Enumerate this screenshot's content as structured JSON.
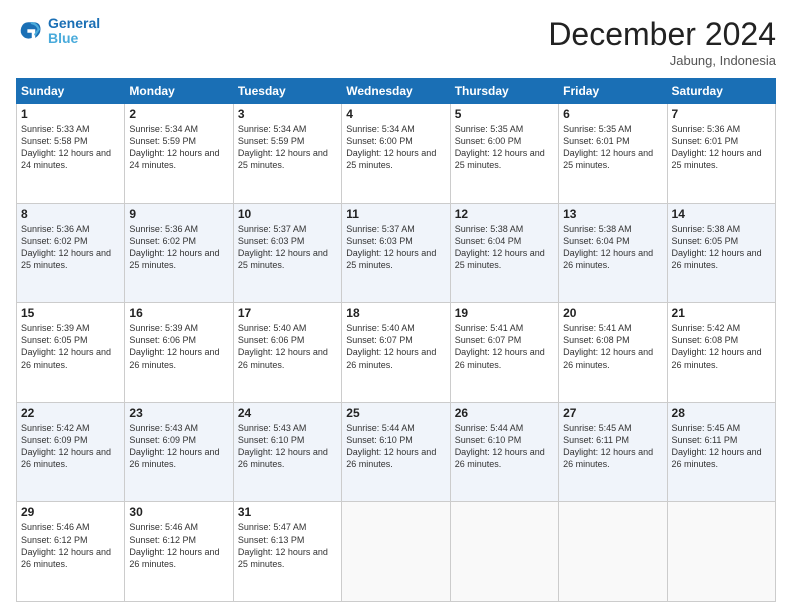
{
  "header": {
    "logo_line1": "General",
    "logo_line2": "Blue",
    "month_title": "December 2024",
    "location": "Jabung, Indonesia"
  },
  "days_of_week": [
    "Sunday",
    "Monday",
    "Tuesday",
    "Wednesday",
    "Thursday",
    "Friday",
    "Saturday"
  ],
  "weeks": [
    [
      {
        "day": "1",
        "sunrise": "5:33 AM",
        "sunset": "5:58 PM",
        "daylight": "12 hours and 24 minutes."
      },
      {
        "day": "2",
        "sunrise": "5:34 AM",
        "sunset": "5:59 PM",
        "daylight": "12 hours and 24 minutes."
      },
      {
        "day": "3",
        "sunrise": "5:34 AM",
        "sunset": "5:59 PM",
        "daylight": "12 hours and 25 minutes."
      },
      {
        "day": "4",
        "sunrise": "5:34 AM",
        "sunset": "6:00 PM",
        "daylight": "12 hours and 25 minutes."
      },
      {
        "day": "5",
        "sunrise": "5:35 AM",
        "sunset": "6:00 PM",
        "daylight": "12 hours and 25 minutes."
      },
      {
        "day": "6",
        "sunrise": "5:35 AM",
        "sunset": "6:01 PM",
        "daylight": "12 hours and 25 minutes."
      },
      {
        "day": "7",
        "sunrise": "5:36 AM",
        "sunset": "6:01 PM",
        "daylight": "12 hours and 25 minutes."
      }
    ],
    [
      {
        "day": "8",
        "sunrise": "5:36 AM",
        "sunset": "6:02 PM",
        "daylight": "12 hours and 25 minutes."
      },
      {
        "day": "9",
        "sunrise": "5:36 AM",
        "sunset": "6:02 PM",
        "daylight": "12 hours and 25 minutes."
      },
      {
        "day": "10",
        "sunrise": "5:37 AM",
        "sunset": "6:03 PM",
        "daylight": "12 hours and 25 minutes."
      },
      {
        "day": "11",
        "sunrise": "5:37 AM",
        "sunset": "6:03 PM",
        "daylight": "12 hours and 25 minutes."
      },
      {
        "day": "12",
        "sunrise": "5:38 AM",
        "sunset": "6:04 PM",
        "daylight": "12 hours and 25 minutes."
      },
      {
        "day": "13",
        "sunrise": "5:38 AM",
        "sunset": "6:04 PM",
        "daylight": "12 hours and 26 minutes."
      },
      {
        "day": "14",
        "sunrise": "5:38 AM",
        "sunset": "6:05 PM",
        "daylight": "12 hours and 26 minutes."
      }
    ],
    [
      {
        "day": "15",
        "sunrise": "5:39 AM",
        "sunset": "6:05 PM",
        "daylight": "12 hours and 26 minutes."
      },
      {
        "day": "16",
        "sunrise": "5:39 AM",
        "sunset": "6:06 PM",
        "daylight": "12 hours and 26 minutes."
      },
      {
        "day": "17",
        "sunrise": "5:40 AM",
        "sunset": "6:06 PM",
        "daylight": "12 hours and 26 minutes."
      },
      {
        "day": "18",
        "sunrise": "5:40 AM",
        "sunset": "6:07 PM",
        "daylight": "12 hours and 26 minutes."
      },
      {
        "day": "19",
        "sunrise": "5:41 AM",
        "sunset": "6:07 PM",
        "daylight": "12 hours and 26 minutes."
      },
      {
        "day": "20",
        "sunrise": "5:41 AM",
        "sunset": "6:08 PM",
        "daylight": "12 hours and 26 minutes."
      },
      {
        "day": "21",
        "sunrise": "5:42 AM",
        "sunset": "6:08 PM",
        "daylight": "12 hours and 26 minutes."
      }
    ],
    [
      {
        "day": "22",
        "sunrise": "5:42 AM",
        "sunset": "6:09 PM",
        "daylight": "12 hours and 26 minutes."
      },
      {
        "day": "23",
        "sunrise": "5:43 AM",
        "sunset": "6:09 PM",
        "daylight": "12 hours and 26 minutes."
      },
      {
        "day": "24",
        "sunrise": "5:43 AM",
        "sunset": "6:10 PM",
        "daylight": "12 hours and 26 minutes."
      },
      {
        "day": "25",
        "sunrise": "5:44 AM",
        "sunset": "6:10 PM",
        "daylight": "12 hours and 26 minutes."
      },
      {
        "day": "26",
        "sunrise": "5:44 AM",
        "sunset": "6:10 PM",
        "daylight": "12 hours and 26 minutes."
      },
      {
        "day": "27",
        "sunrise": "5:45 AM",
        "sunset": "6:11 PM",
        "daylight": "12 hours and 26 minutes."
      },
      {
        "day": "28",
        "sunrise": "5:45 AM",
        "sunset": "6:11 PM",
        "daylight": "12 hours and 26 minutes."
      }
    ],
    [
      {
        "day": "29",
        "sunrise": "5:46 AM",
        "sunset": "6:12 PM",
        "daylight": "12 hours and 26 minutes."
      },
      {
        "day": "30",
        "sunrise": "5:46 AM",
        "sunset": "6:12 PM",
        "daylight": "12 hours and 26 minutes."
      },
      {
        "day": "31",
        "sunrise": "5:47 AM",
        "sunset": "6:13 PM",
        "daylight": "12 hours and 25 minutes."
      },
      null,
      null,
      null,
      null
    ]
  ]
}
